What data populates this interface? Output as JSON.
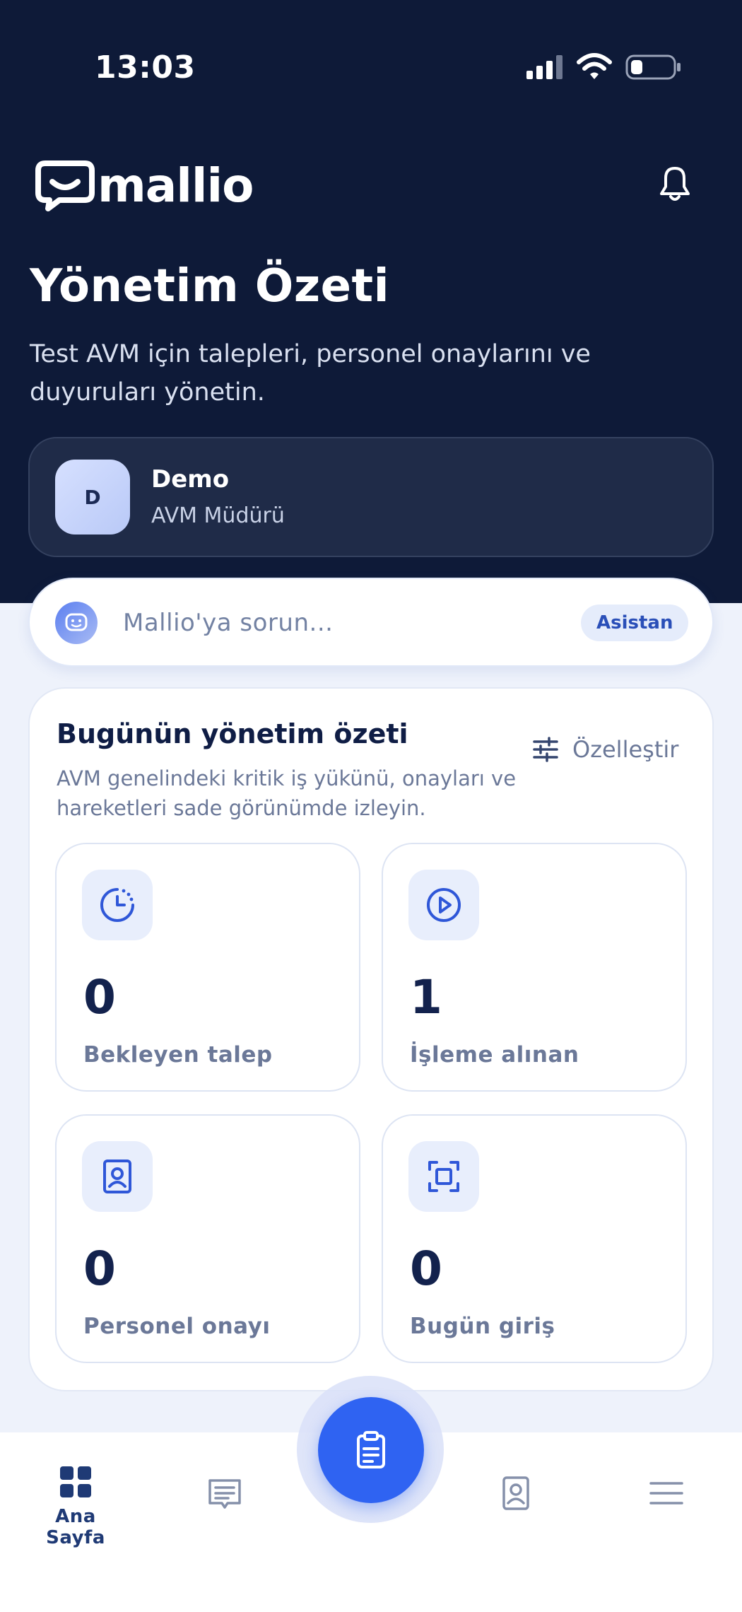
{
  "status_bar": {
    "time": "13:03"
  },
  "header": {
    "brand": "mallio",
    "title": "Yönetim Özeti",
    "subtitle": "Test AVM için talepleri, personel onaylarını ve duyuruları yönetin."
  },
  "profile": {
    "initial": "D",
    "name": "Demo",
    "role": "AVM Müdürü"
  },
  "assistant": {
    "placeholder": "Mallio'ya sorun...",
    "badge": "Asistan"
  },
  "summary": {
    "title": "Bugünün yönetim özeti",
    "description": "AVM genelindeki kritik iş yükünü, onayları ve hareketleri sade görünümde izleyin.",
    "customize_label": "Özelleştir",
    "stats": [
      {
        "value": "0",
        "label": "Bekleyen talep",
        "icon": "clock-pending-icon"
      },
      {
        "value": "1",
        "label": "İşleme alınan",
        "icon": "play-circle-icon"
      },
      {
        "value": "0",
        "label": "Personel onayı",
        "icon": "id-badge-icon"
      },
      {
        "value": "0",
        "label": "Bugün giriş",
        "icon": "scan-frame-icon"
      }
    ]
  },
  "bottom_nav": {
    "items": [
      {
        "label": "Ana Sayfa",
        "icon": "grid-icon",
        "active": true
      },
      {
        "label": "",
        "icon": "message-icon"
      },
      {
        "label": "",
        "icon": "clipboard-icon"
      },
      {
        "label": "",
        "icon": "id-badge-icon"
      },
      {
        "label": "",
        "icon": "menu-icon"
      }
    ]
  },
  "colors": {
    "hero_bg": "#0e1a38",
    "accent": "#2f63f2",
    "page_bg": "#eef2fb"
  }
}
